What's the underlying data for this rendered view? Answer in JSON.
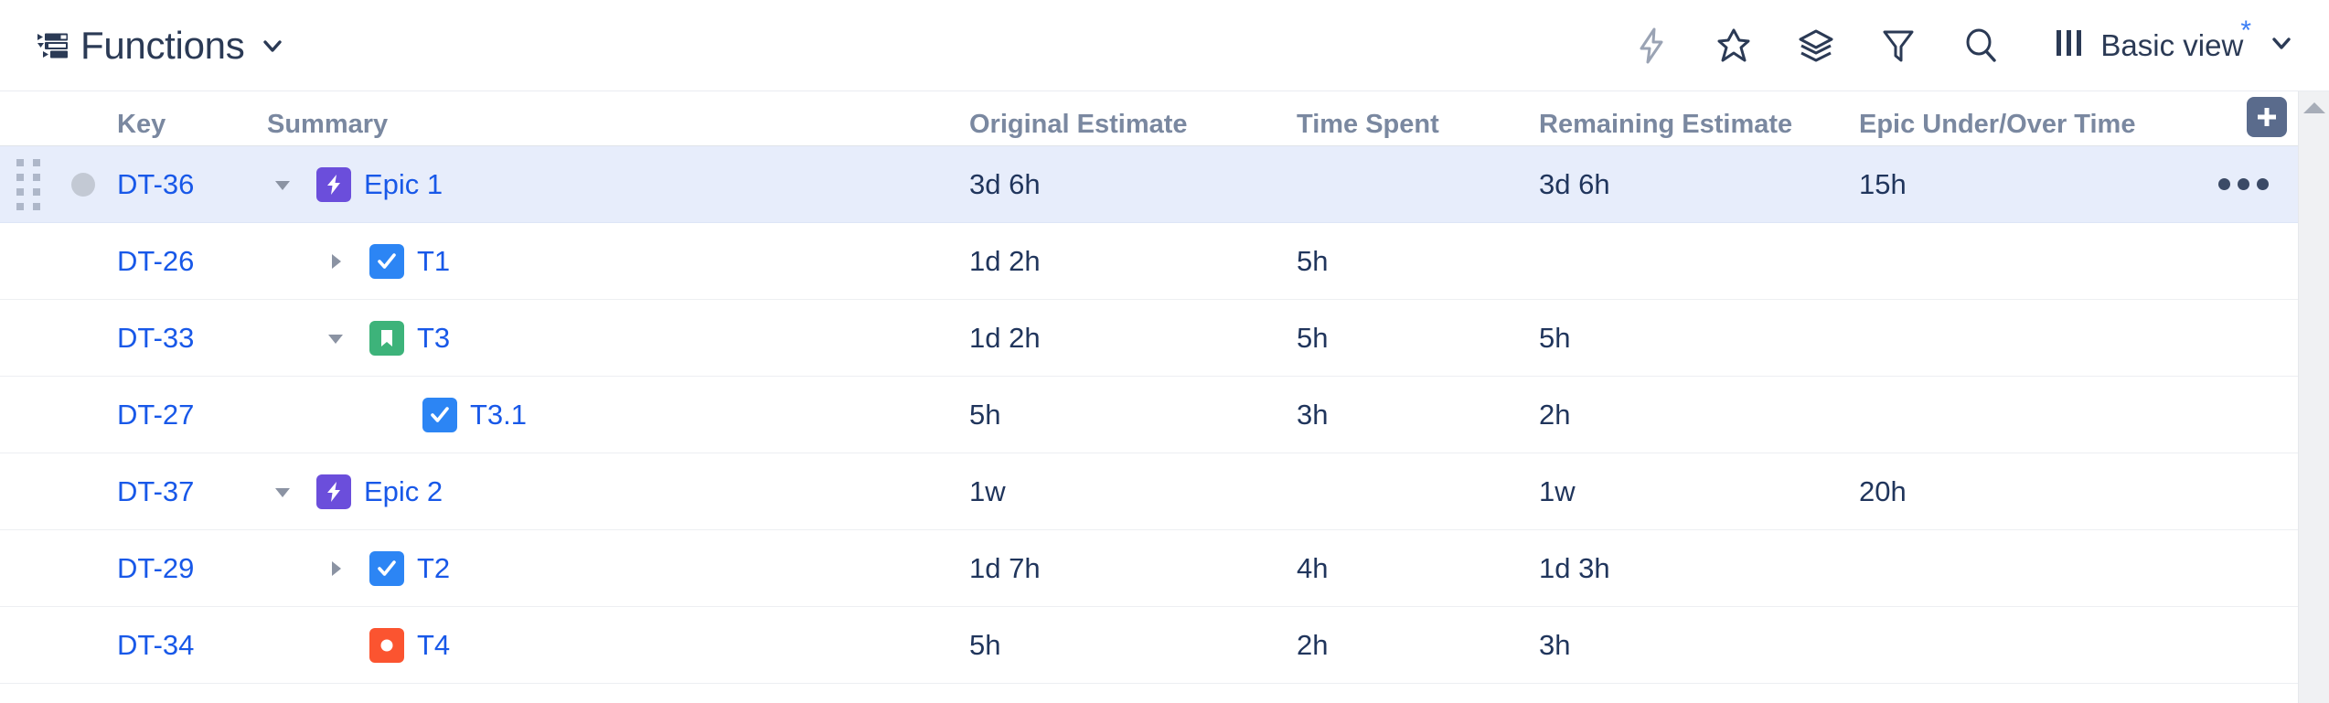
{
  "header": {
    "title": "Functions",
    "structure_icon": "structure-tree-icon",
    "title_chevron_icon": "chevron-down-icon",
    "tools": [
      {
        "name": "automation-lightning-icon",
        "label": "Automation",
        "disabled": true
      },
      {
        "name": "pin-icon",
        "label": "Pin"
      },
      {
        "name": "layers-icon",
        "label": "Layers"
      },
      {
        "name": "filter-funnel-icon",
        "label": "Filter"
      },
      {
        "name": "search-icon",
        "label": "Search"
      },
      {
        "name": "columns-icon",
        "label": "Columns"
      }
    ],
    "view": {
      "label": "Basic view",
      "modified_marker": "*",
      "chevron_icon": "chevron-down-icon"
    }
  },
  "table": {
    "columns": [
      {
        "key": "key",
        "label": "Key"
      },
      {
        "key": "summary",
        "label": "Summary"
      },
      {
        "key": "original",
        "label": "Original Estimate"
      },
      {
        "key": "spent",
        "label": "Time Spent"
      },
      {
        "key": "remaining",
        "label": "Remaining Estimate"
      },
      {
        "key": "epicovr",
        "label": "Epic Under/Over Time"
      }
    ],
    "add_column_label": "+",
    "more_actions_label": "...",
    "rows": [
      {
        "key": "DT-36",
        "summary": "Epic 1",
        "type": "epic",
        "indent": 0,
        "twisty": "expanded",
        "selected": true,
        "original": "3d 6h",
        "spent": "",
        "remaining": "3d 6h",
        "epicovr": "15h"
      },
      {
        "key": "DT-26",
        "summary": "T1",
        "type": "task",
        "indent": 1,
        "twisty": "collapsed",
        "selected": false,
        "original": "1d 2h",
        "spent": "5h",
        "remaining": "",
        "epicovr": ""
      },
      {
        "key": "DT-33",
        "summary": "T3",
        "type": "story",
        "indent": 1,
        "twisty": "expanded",
        "selected": false,
        "original": "1d 2h",
        "spent": "5h",
        "remaining": "5h",
        "epicovr": ""
      },
      {
        "key": "DT-27",
        "summary": "T3.1",
        "type": "task",
        "indent": 2,
        "twisty": "none",
        "selected": false,
        "original": "5h",
        "spent": "3h",
        "remaining": "2h",
        "epicovr": ""
      },
      {
        "key": "DT-37",
        "summary": "Epic 2",
        "type": "epic",
        "indent": 0,
        "twisty": "expanded",
        "selected": false,
        "original": "1w",
        "spent": "",
        "remaining": "1w",
        "epicovr": "20h"
      },
      {
        "key": "DT-29",
        "summary": "T2",
        "type": "task",
        "indent": 1,
        "twisty": "collapsed",
        "selected": false,
        "original": "1d 7h",
        "spent": "4h",
        "remaining": "1d 3h",
        "epicovr": ""
      },
      {
        "key": "DT-34",
        "summary": "T4",
        "type": "bug",
        "indent": 1,
        "twisty": "none",
        "selected": false,
        "original": "5h",
        "spent": "2h",
        "remaining": "3h",
        "epicovr": ""
      }
    ]
  },
  "colors": {
    "link": "#1858e8",
    "text": "#20355c",
    "header_text": "#7a88a0",
    "selected_row": "#e7edfb",
    "epic": "#6b4edb",
    "task": "#2c85f4",
    "story": "#3db37a",
    "bug": "#fb5430",
    "accent_star": "#3b7ef5"
  },
  "scrollbar": {
    "up_arrow_icon": "triangle-up-icon"
  }
}
